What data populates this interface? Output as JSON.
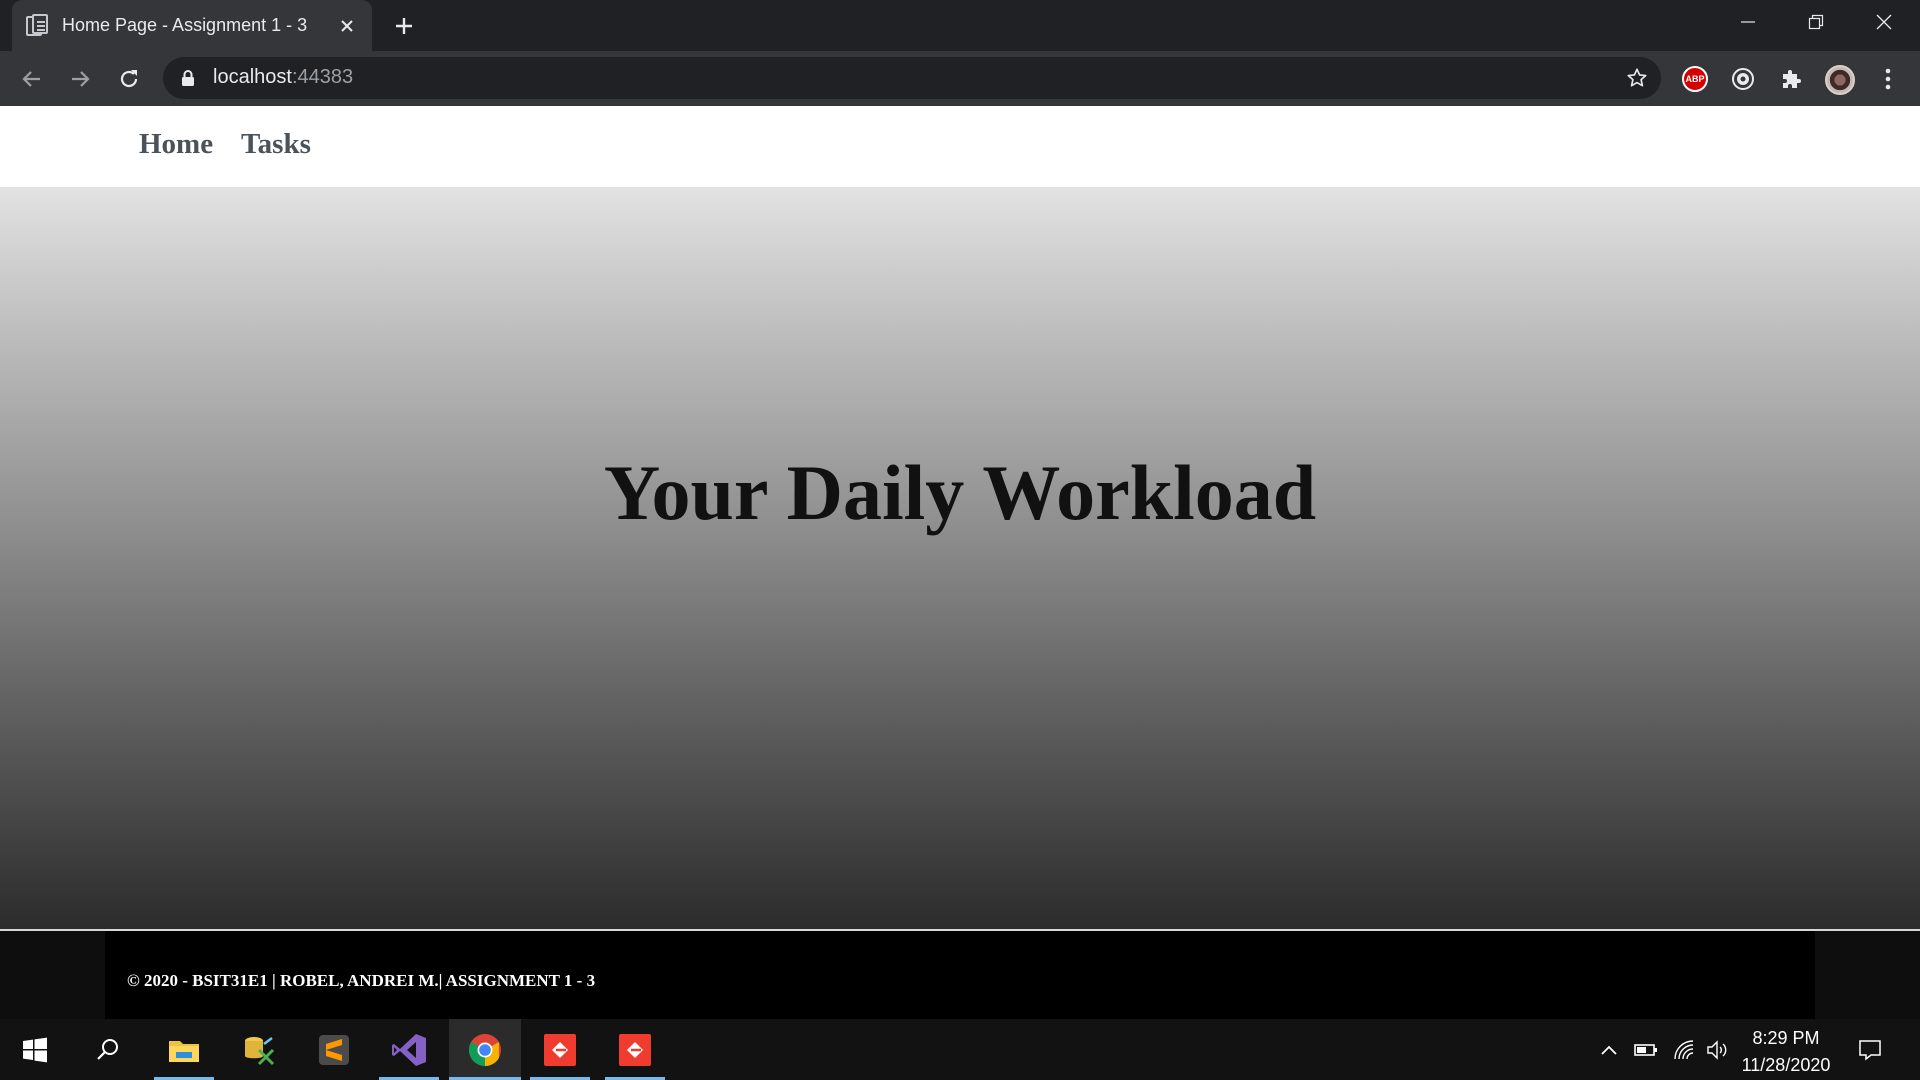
{
  "browser": {
    "tab_title": "Home Page - Assignment 1 - 3",
    "url_host": "localhost",
    "url_port": ":44383",
    "extensions": {
      "abp_label": "ABP"
    }
  },
  "site": {
    "nav": [
      "Home",
      "Tasks"
    ],
    "hero_title": "Your Daily Workload",
    "footer_text": "© 2020 - BSIT31E1 | ROBEL, ANDREI M.| ASSIGNMENT 1 - 3"
  },
  "taskbar": {
    "time": "8:29 PM",
    "date": "11/28/2020"
  },
  "colors": {
    "chrome_dark": "#202124",
    "chrome_toolbar": "#35363a",
    "nav_text": "#4a525a",
    "taskbar_accent": "#76b9ed"
  }
}
